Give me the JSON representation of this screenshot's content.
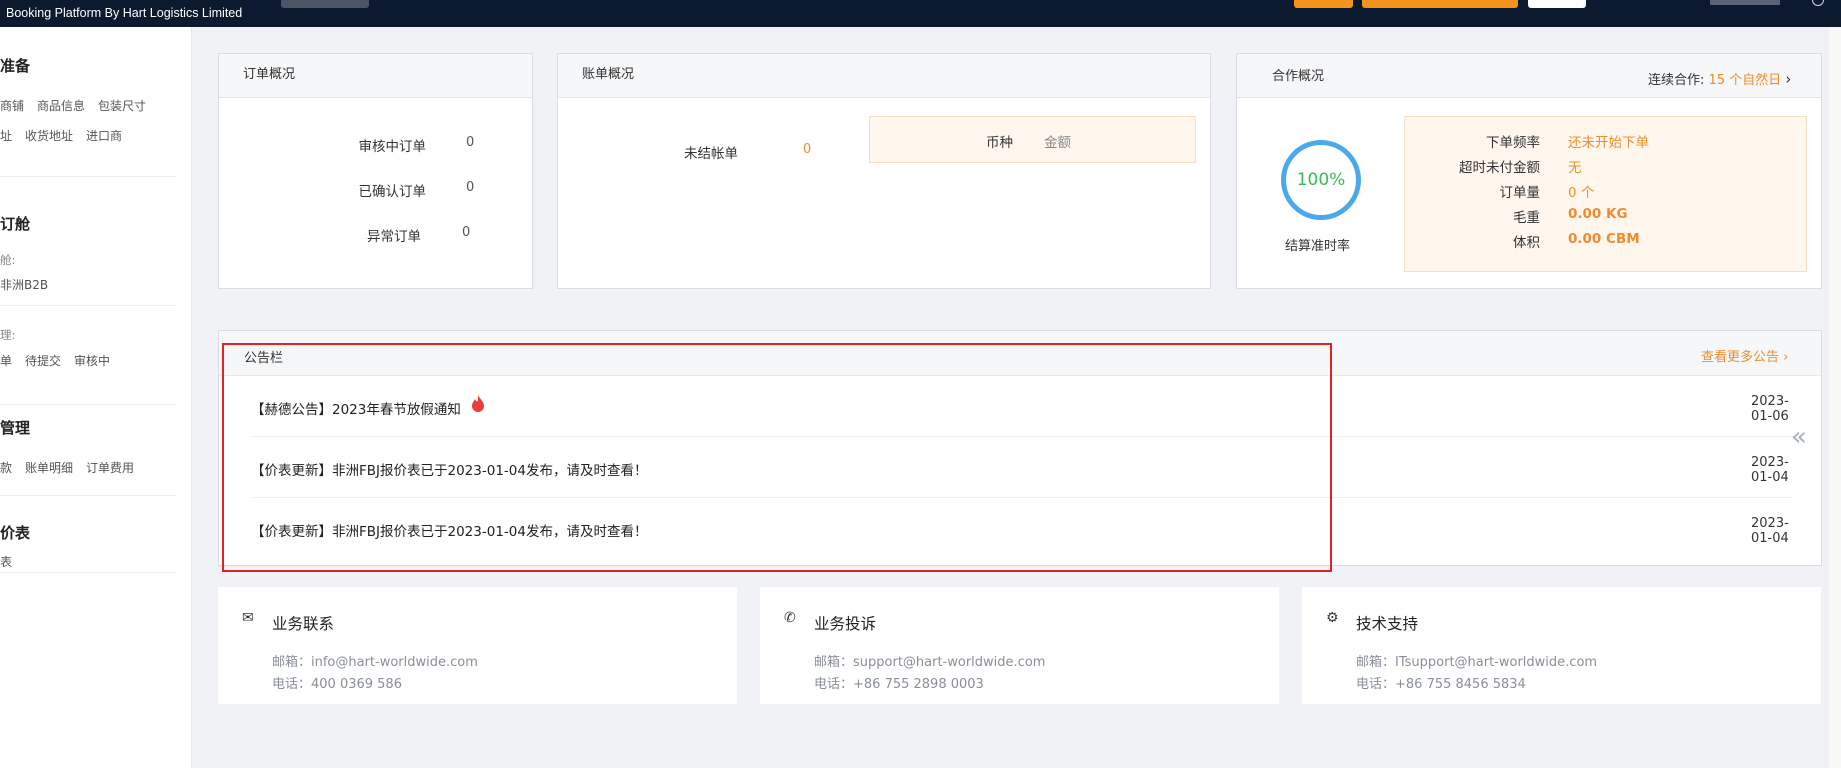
{
  "header": {
    "brand": "Booking Platform By Hart Logistics Limited"
  },
  "sidebar": {
    "sections": [
      {
        "title": "准备",
        "links": [
          "商铺",
          "商品信息",
          "包装尺寸"
        ],
        "links2": [
          "址",
          "收货地址",
          "进口商"
        ]
      },
      {
        "title": "订舱",
        "label1": "舱:",
        "item": "非洲B2B",
        "label2": "理:",
        "links": [
          "单",
          "待提交",
          "审核中"
        ]
      },
      {
        "title": "管理",
        "links": [
          "款",
          "账单明细",
          "订单费用"
        ]
      },
      {
        "title": "价表",
        "links": [
          "表"
        ]
      }
    ]
  },
  "orders": {
    "title": "订单概况",
    "rows": [
      {
        "label": "审核中订单",
        "value": "0"
      },
      {
        "label": "已确认订单",
        "value": "0"
      },
      {
        "label": "异常订单",
        "value": "0"
      }
    ]
  },
  "bills": {
    "title": "账单概况",
    "unsettled_label": "未结帐单",
    "unsettled_value": "0",
    "currency_label": "币种",
    "amount_label": "金额"
  },
  "coop": {
    "title": "合作概况",
    "continuous_label": "连续合作:",
    "continuous_value": "15 个自然日",
    "percent": "100%",
    "percent_label": "结算准时率",
    "rows": [
      {
        "k": "下单频率",
        "v": "还未开始下单"
      },
      {
        "k": "超时未付金额",
        "v": "无"
      },
      {
        "k": "订单量",
        "v": "0 个"
      },
      {
        "k": "毛重",
        "v": "0.00 KG"
      },
      {
        "k": "体积",
        "v": "0.00 CBM"
      }
    ]
  },
  "notices": {
    "title": "公告栏",
    "more": "查看更多公告",
    "items": [
      {
        "text": "【赫德公告】2023年春节放假通知",
        "date": "2023-01-06"
      },
      {
        "text": "【价表更新】非洲FBJ报价表已于2023-01-04发布，请及时查看！",
        "date": "2023-01-04"
      },
      {
        "text": "【价表更新】非洲FBJ报价表已于2023-01-04发布，请及时查看！",
        "date": "2023-01-04"
      }
    ]
  },
  "contacts": [
    {
      "title": "业务联系",
      "icon": "mail-icon",
      "email": "邮箱：info@hart-worldwide.com",
      "phone": "电话：400 0369 586"
    },
    {
      "title": "业务投诉",
      "icon": "phone-icon",
      "email": "邮箱：support@hart-worldwide.com",
      "phone": "电话：+86 755 2898 0003"
    },
    {
      "title": "技术支持",
      "icon": "gear-icon",
      "email": "邮箱：ITsupport@hart-worldwide.com",
      "phone": "电话：+86 755 8456 5834"
    }
  ]
}
